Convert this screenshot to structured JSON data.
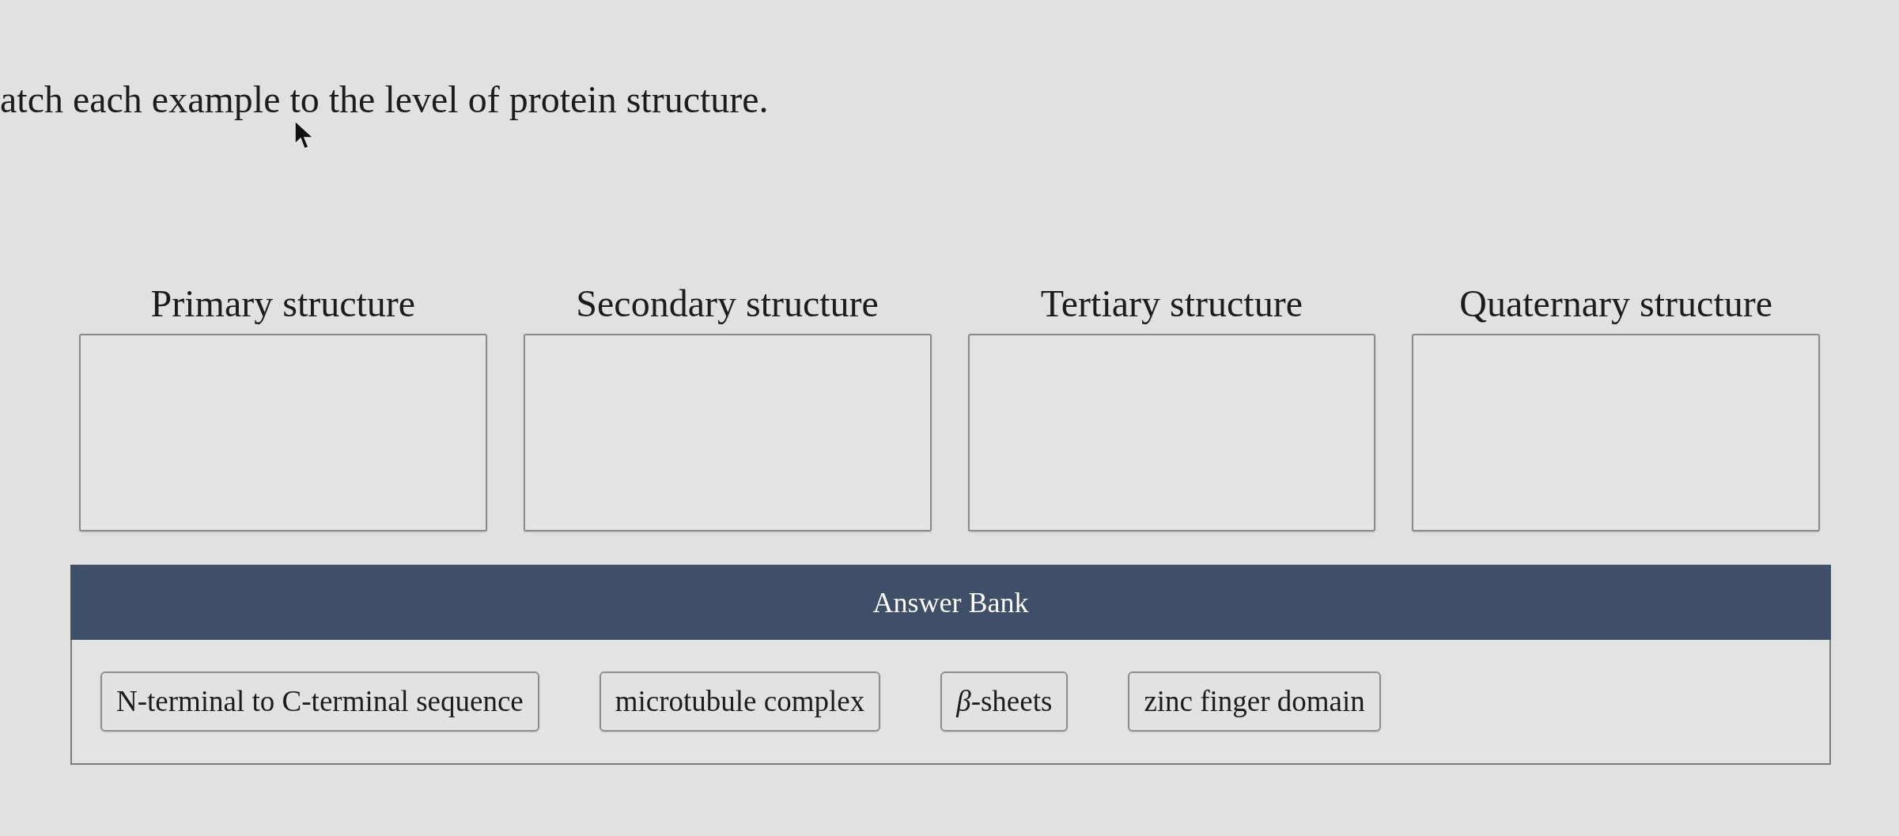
{
  "instruction": "atch each example to the level of protein structure.",
  "targets": [
    {
      "label": "Primary structure"
    },
    {
      "label": "Secondary structure"
    },
    {
      "label": "Tertiary structure"
    },
    {
      "label": "Quaternary structure"
    }
  ],
  "answer_bank": {
    "title": "Answer Bank",
    "items": [
      "N-terminal to C-terminal sequence",
      "microtubule complex",
      "*β*-sheets",
      "zinc finger domain"
    ]
  }
}
